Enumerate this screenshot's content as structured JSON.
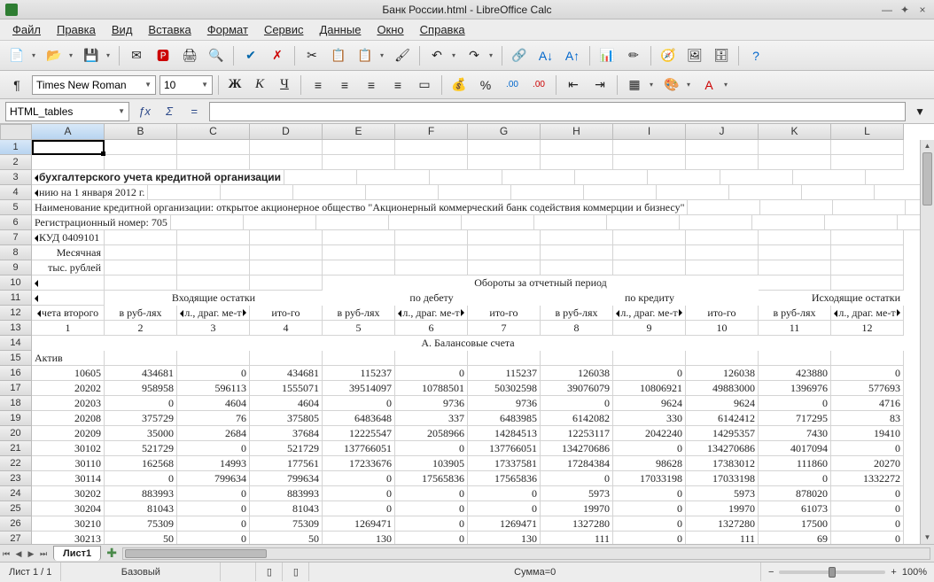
{
  "window": {
    "title": "Банк России.html - LibreOffice Calc"
  },
  "menu": [
    "Файл",
    "Правка",
    "Вид",
    "Вставка",
    "Формат",
    "Сервис",
    "Данные",
    "Окно",
    "Справка"
  ],
  "namebox": "HTML_tables",
  "formula_eq": "=",
  "font": {
    "name": "Times New Roman",
    "size": "10"
  },
  "cols": [
    "A",
    "B",
    "C",
    "D",
    "E",
    "F",
    "G",
    "H",
    "I",
    "J",
    "K",
    "L"
  ],
  "rows": [
    "1",
    "2",
    "3",
    "4",
    "5",
    "6",
    "7",
    "8",
    "9",
    "10",
    "11",
    "12",
    "13",
    "14",
    "15",
    "16",
    "17",
    "18",
    "19",
    "20",
    "21",
    "22",
    "23",
    "24",
    "25",
    "26",
    "27"
  ],
  "tab": "Лист1",
  "status": {
    "sheet": "Лист 1 / 1",
    "style": "Базовый",
    "sum": "Сумма=0",
    "zoom": "100%"
  },
  "text": {
    "r3": "бухгалтерского учета кредитной организации",
    "r4": "нию на 1 января 2012 г.",
    "r5": "Наименование кредитной организации: открытое акционерное общество \"Акционерный коммерческий банк содействия коммерции и бизнесу\"",
    "r6": "Регистрационный номер: 705",
    "r7": "КУД 0409101",
    "r8": "Месячная",
    "r9": "тыс. рублей",
    "r10g": "Обороты за отчетный период",
    "r11_in": "Входящие остатки",
    "r11_deb": "по дебету",
    "r11_cred": "по кредиту",
    "r11_out": "Исходящие остатки",
    "h_a": "чета второго",
    "h_rub": "в руб-лях",
    "h_drag": "л., драг. ме-т",
    "h_itogo": "ито-го",
    "r13_nums": [
      "1",
      "2",
      "3",
      "4",
      "5",
      "6",
      "7",
      "8",
      "9",
      "10",
      "11",
      "12"
    ],
    "r14": "А. Балансовые счета",
    "r15": "Актив"
  },
  "data": [
    [
      "10605",
      "434681",
      "0",
      "434681",
      "115237",
      "0",
      "115237",
      "126038",
      "0",
      "126038",
      "423880",
      "0"
    ],
    [
      "20202",
      "958958",
      "596113",
      "1555071",
      "39514097",
      "10788501",
      "50302598",
      "39076079",
      "10806921",
      "49883000",
      "1396976",
      "577693"
    ],
    [
      "20203",
      "0",
      "4604",
      "4604",
      "0",
      "9736",
      "9736",
      "0",
      "9624",
      "9624",
      "0",
      "4716"
    ],
    [
      "20208",
      "375729",
      "76",
      "375805",
      "6483648",
      "337",
      "6483985",
      "6142082",
      "330",
      "6142412",
      "717295",
      "83"
    ],
    [
      "20209",
      "35000",
      "2684",
      "37684",
      "12225547",
      "2058966",
      "14284513",
      "12253117",
      "2042240",
      "14295357",
      "7430",
      "19410"
    ],
    [
      "30102",
      "521729",
      "0",
      "521729",
      "137766051",
      "0",
      "137766051",
      "134270686",
      "0",
      "134270686",
      "4017094",
      "0"
    ],
    [
      "30110",
      "162568",
      "14993",
      "177561",
      "17233676",
      "103905",
      "17337581",
      "17284384",
      "98628",
      "17383012",
      "111860",
      "20270"
    ],
    [
      "30114",
      "0",
      "799634",
      "799634",
      "0",
      "17565836",
      "17565836",
      "0",
      "17033198",
      "17033198",
      "0",
      "1332272"
    ],
    [
      "30202",
      "883993",
      "0",
      "883993",
      "0",
      "0",
      "0",
      "5973",
      "0",
      "5973",
      "878020",
      "0"
    ],
    [
      "30204",
      "81043",
      "0",
      "81043",
      "0",
      "0",
      "0",
      "19970",
      "0",
      "19970",
      "61073",
      "0"
    ],
    [
      "30210",
      "75309",
      "0",
      "75309",
      "1269471",
      "0",
      "1269471",
      "1327280",
      "0",
      "1327280",
      "17500",
      "0"
    ],
    [
      "30213",
      "50",
      "0",
      "50",
      "130",
      "0",
      "130",
      "111",
      "0",
      "111",
      "69",
      "0"
    ]
  ]
}
